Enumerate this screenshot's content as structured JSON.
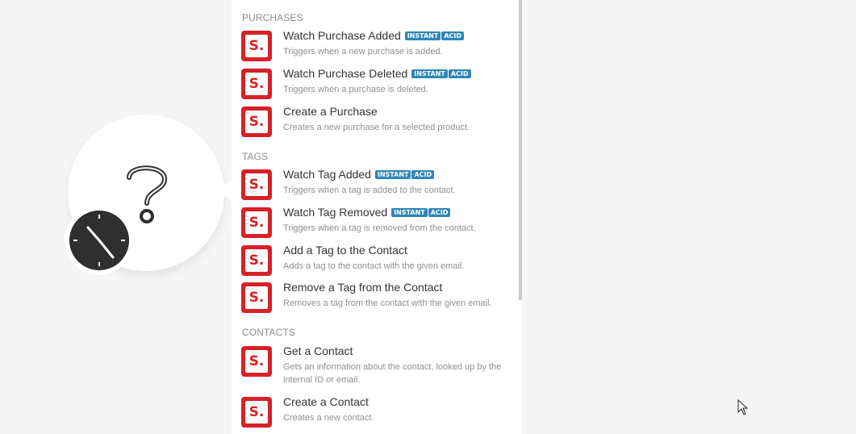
{
  "sections": [
    {
      "header": "PURCHASES",
      "items": [
        {
          "title": "Watch Purchase Added",
          "badges": [
            "INSTANT",
            "ACID"
          ],
          "description": "Triggers when a new purchase is added."
        },
        {
          "title": "Watch Purchase Deleted",
          "badges": [
            "INSTANT",
            "ACID"
          ],
          "description": "Triggers when a purchase is deleted."
        },
        {
          "title": "Create a Purchase",
          "badges": [],
          "description": "Creates a new purchase for a selected product."
        }
      ]
    },
    {
      "header": "TAGS",
      "items": [
        {
          "title": "Watch Tag Added",
          "badges": [
            "INSTANT",
            "ACID"
          ],
          "description": "Triggers when a tag is added to the contact."
        },
        {
          "title": "Watch Tag Removed",
          "badges": [
            "INSTANT",
            "ACID"
          ],
          "description": "Triggers when a tag is removed from the contact."
        },
        {
          "title": "Add a Tag to the Contact",
          "badges": [],
          "description": "Adds a tag to the contact with the given email."
        },
        {
          "title": "Remove a Tag from the Contact",
          "badges": [],
          "description": "Removes a tag from the contact with the given email."
        }
      ]
    },
    {
      "header": "CONTACTS",
      "items": [
        {
          "title": "Get a Contact",
          "badges": [],
          "description": "Gets an information about the contact, looked up by the internal ID or email."
        },
        {
          "title": "Create a Contact",
          "badges": [],
          "description": "Creates a new contact."
        }
      ]
    }
  ],
  "app_icon_letter": "S.",
  "icons": {
    "module": "question-mark-icon",
    "trigger": "clock-icon",
    "app": "app-logo-icon",
    "cursor": "mouse-cursor-icon"
  },
  "colors": {
    "app_red": "#d72027",
    "badge_blue": "#2f86b8",
    "clock_dark": "#2f2f2f"
  }
}
